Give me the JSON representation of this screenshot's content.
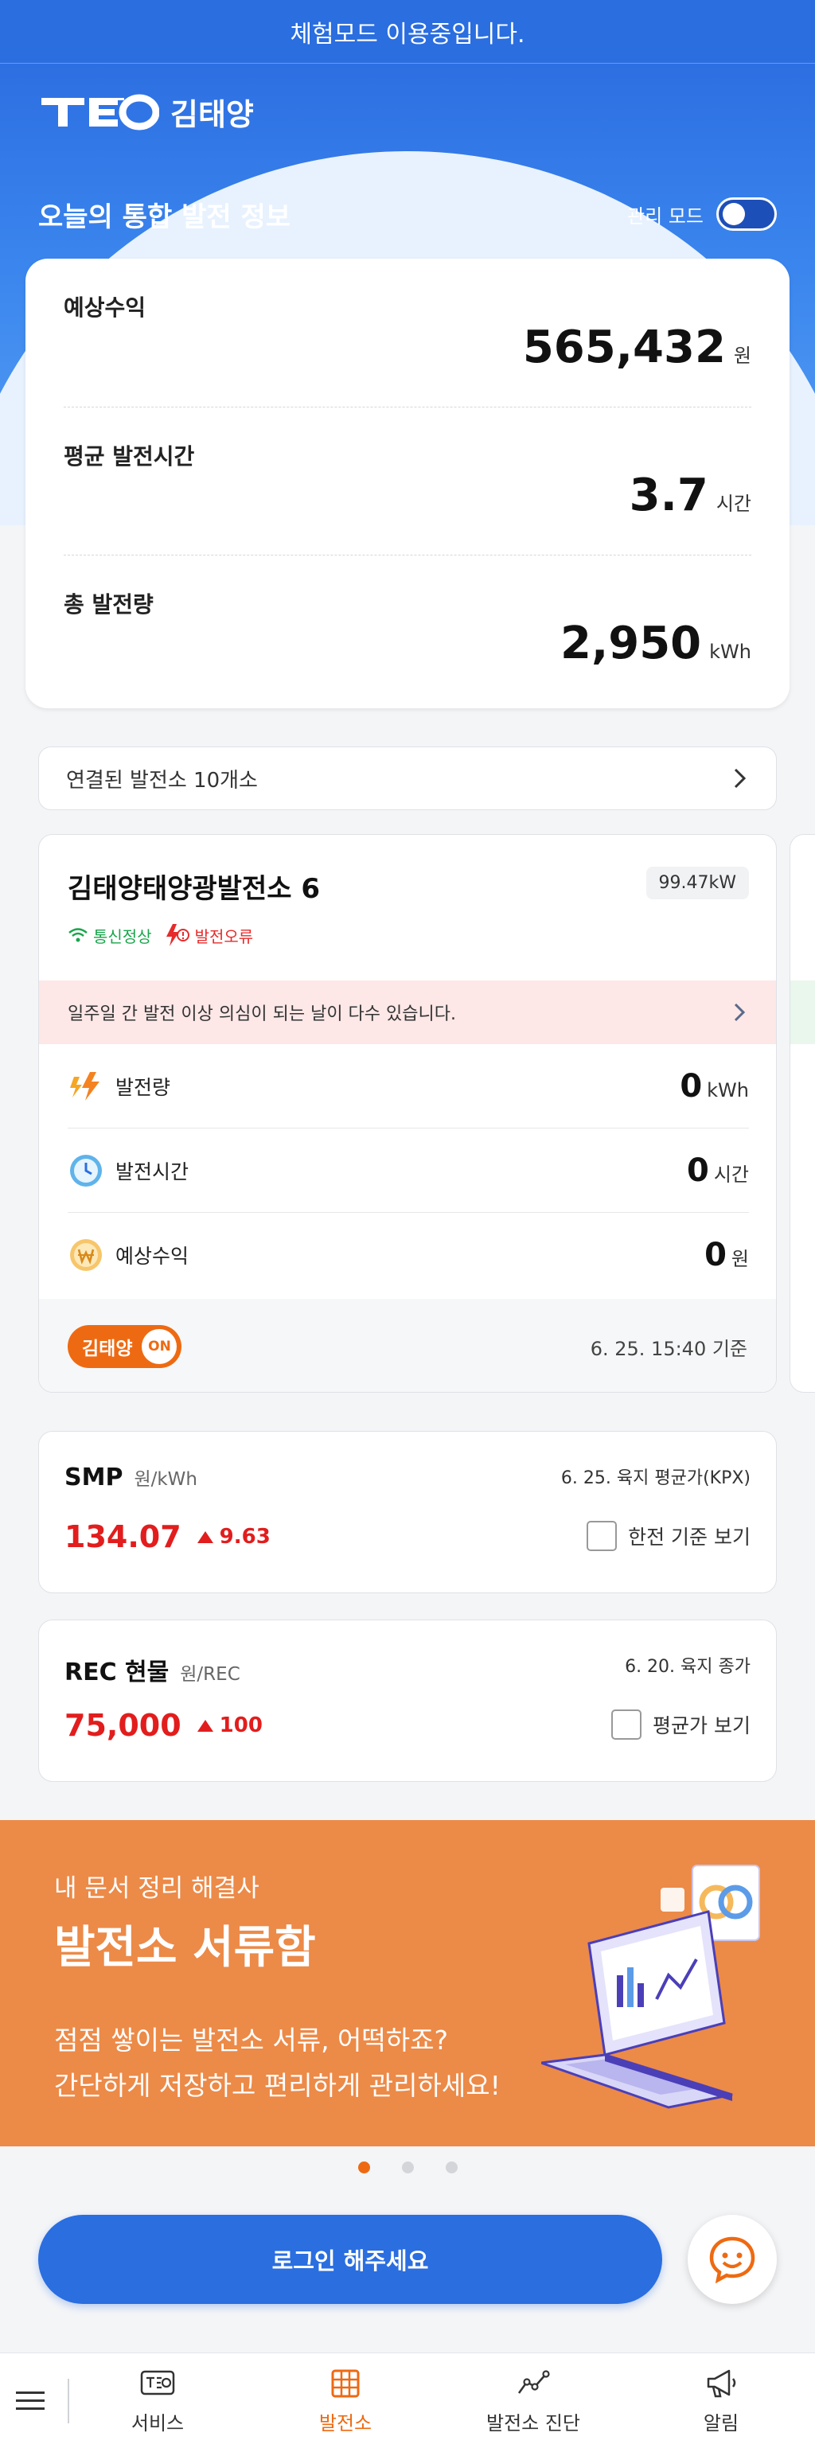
{
  "demo_banner": "체험모드 이용중입니다.",
  "header": {
    "user_name": "김태양",
    "logo_text": "TEO"
  },
  "summary": {
    "title": "오늘의 통합 발전 정보",
    "admin_mode_label": "관리 모드",
    "admin_mode_on": false,
    "rows": [
      {
        "label": "예상수익",
        "value": "565,432",
        "unit": "원"
      },
      {
        "label": "평균 발전시간",
        "value": "3.7",
        "unit": "시간"
      },
      {
        "label": "총 발전량",
        "value": "2,950",
        "unit": "kWh"
      }
    ]
  },
  "connected": {
    "text": "연결된 발전소 10개소"
  },
  "plant": {
    "name": "김태양태양광발전소 6",
    "capacity": "99.47kW",
    "status_ok": "통신정상",
    "status_err": "발전오류",
    "alert": "일주일 간 발전 이상 의심이 되는 날이 다수 있습니다.",
    "metrics": [
      {
        "label": "발전량",
        "value": "0",
        "unit": "kWh",
        "icon": "lightning-icon"
      },
      {
        "label": "발전시간",
        "value": "0",
        "unit": "시간",
        "icon": "clock-icon"
      },
      {
        "label": "예상수익",
        "value": "0",
        "unit": "원",
        "icon": "won-coin-icon"
      }
    ],
    "owner_badge": "김태양",
    "on_label": "ON",
    "updated": "6. 25. 15:40 기준"
  },
  "smp": {
    "name": "SMP",
    "unit": "원/kWh",
    "date": "6. 25. 육지 평균가(KPX)",
    "value": "134.07",
    "delta": "9.63",
    "check_label": "한전 기준 보기",
    "checked": false
  },
  "rec": {
    "name": "REC 현물",
    "unit": "원/REC",
    "date": "6. 20. 육지 종가",
    "value": "75,000",
    "delta": "100",
    "check_label": "평균가 보기",
    "checked": false
  },
  "banner": {
    "subtitle": "내 문서 정리 해결사",
    "title": "발전소 서류함",
    "desc_line1": "점점 쌓이는 발전소 서류, 어떡하죠?",
    "desc_line2": "간단하게 저장하고 편리하게 관리하세요!",
    "bg_color": "#ec8a48"
  },
  "carousel": {
    "active_index": 0,
    "count": 3
  },
  "login_button": "로그인 해주세요",
  "nav": {
    "items": [
      {
        "label": "서비스",
        "icon": "teo-service-icon"
      },
      {
        "label": "발전소",
        "icon": "grid-panel-icon",
        "active": true
      },
      {
        "label": "발전소 진단",
        "icon": "diagnosis-chart-icon"
      },
      {
        "label": "알림",
        "icon": "megaphone-icon"
      }
    ]
  },
  "colors": {
    "primary": "#2a6ee0",
    "accent": "#ee6a12",
    "danger": "#e21d1d",
    "ok": "#18a54a"
  }
}
